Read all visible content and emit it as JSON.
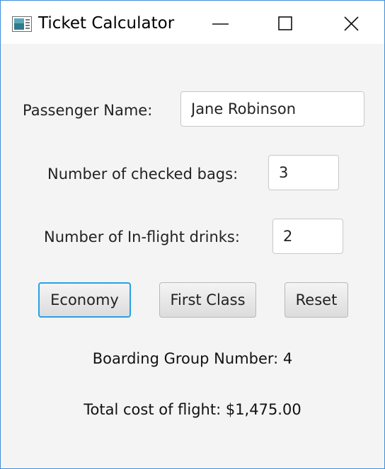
{
  "window": {
    "title": "Ticket Calculator",
    "controls": {
      "minimize_icon": "minimize-icon",
      "maximize_icon": "maximize-icon",
      "close_icon": "close-icon"
    }
  },
  "form": {
    "passenger_label": "Passenger Name:",
    "passenger_value": "Jane Robinson",
    "bags_label": "Number of checked bags:",
    "bags_value": "3",
    "drinks_label": "Number of In-flight drinks:",
    "drinks_value": "2"
  },
  "buttons": {
    "economy": "Economy",
    "first_class": "First Class",
    "reset": "Reset"
  },
  "results": {
    "boarding_group": "Boarding Group Number: 4",
    "total_cost": "Total cost of flight: $1,475.00"
  },
  "colors": {
    "focus_ring": "#2aa0e4",
    "window_border": "#3f8fd8",
    "background": "#f4f4f4"
  }
}
